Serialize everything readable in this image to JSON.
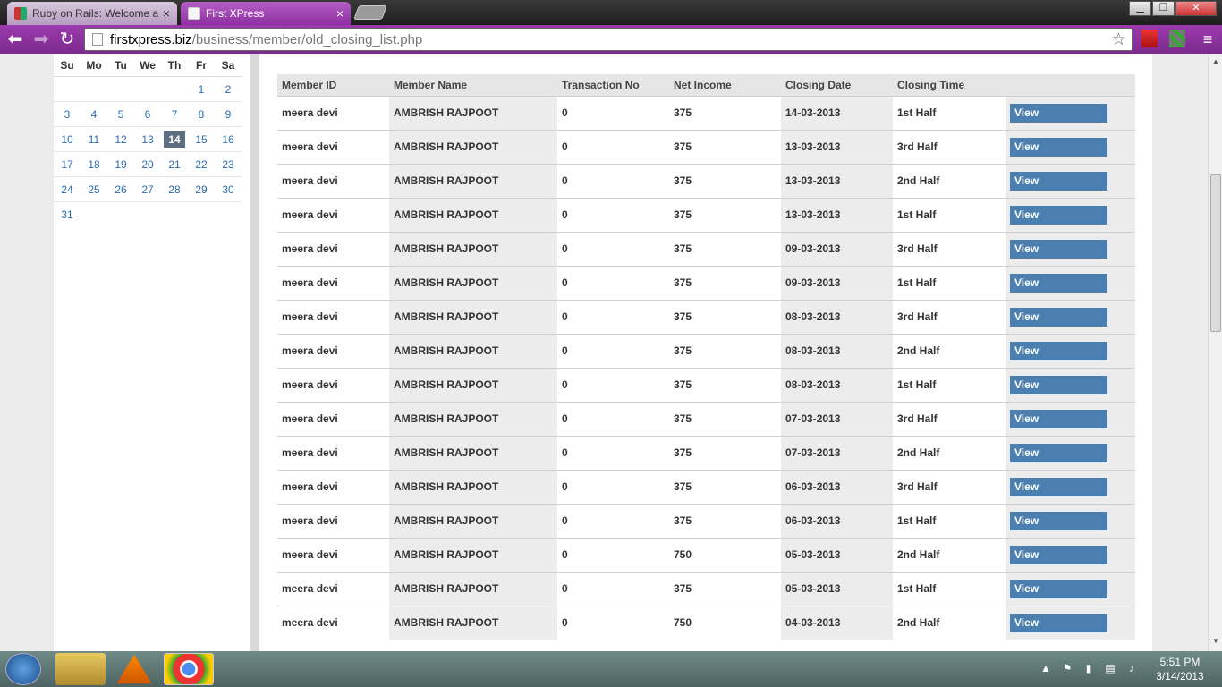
{
  "browser": {
    "tabs": [
      {
        "title": "Ruby on Rails: Welcome a",
        "active": false
      },
      {
        "title": "First XPress",
        "active": true
      }
    ],
    "address": {
      "host": "firstxpress.biz",
      "path": "/business/member/old_closing_list.php"
    }
  },
  "calendar": {
    "weekdays": [
      "Su",
      "Mo",
      "Tu",
      "We",
      "Th",
      "Fr",
      "Sa"
    ],
    "weeks": [
      [
        "",
        "",
        "",
        "",
        "",
        "1",
        "2"
      ],
      [
        "3",
        "4",
        "5",
        "6",
        "7",
        "8",
        "9"
      ],
      [
        "10",
        "11",
        "12",
        "13",
        "14",
        "15",
        "16"
      ],
      [
        "17",
        "18",
        "19",
        "20",
        "21",
        "22",
        "23"
      ],
      [
        "24",
        "25",
        "26",
        "27",
        "28",
        "29",
        "30"
      ],
      [
        "31",
        "",
        "",
        "",
        "",
        "",
        ""
      ]
    ],
    "today": "14"
  },
  "table": {
    "headers": [
      "Member ID",
      "Member Name",
      "Transaction No",
      "Net Income",
      "Closing Date",
      "Closing Time",
      ""
    ],
    "view_label": "View",
    "rows": [
      [
        "meera devi",
        "AMBRISH RAJPOOT",
        "0",
        "375",
        "14-03-2013",
        "1st Half"
      ],
      [
        "meera devi",
        "AMBRISH RAJPOOT",
        "0",
        "375",
        "13-03-2013",
        "3rd Half"
      ],
      [
        "meera devi",
        "AMBRISH RAJPOOT",
        "0",
        "375",
        "13-03-2013",
        "2nd Half"
      ],
      [
        "meera devi",
        "AMBRISH RAJPOOT",
        "0",
        "375",
        "13-03-2013",
        "1st Half"
      ],
      [
        "meera devi",
        "AMBRISH RAJPOOT",
        "0",
        "375",
        "09-03-2013",
        "3rd Half"
      ],
      [
        "meera devi",
        "AMBRISH RAJPOOT",
        "0",
        "375",
        "09-03-2013",
        "1st Half"
      ],
      [
        "meera devi",
        "AMBRISH RAJPOOT",
        "0",
        "375",
        "08-03-2013",
        "3rd Half"
      ],
      [
        "meera devi",
        "AMBRISH RAJPOOT",
        "0",
        "375",
        "08-03-2013",
        "2nd Half"
      ],
      [
        "meera devi",
        "AMBRISH RAJPOOT",
        "0",
        "375",
        "08-03-2013",
        "1st Half"
      ],
      [
        "meera devi",
        "AMBRISH RAJPOOT",
        "0",
        "375",
        "07-03-2013",
        "3rd Half"
      ],
      [
        "meera devi",
        "AMBRISH RAJPOOT",
        "0",
        "375",
        "07-03-2013",
        "2nd Half"
      ],
      [
        "meera devi",
        "AMBRISH RAJPOOT",
        "0",
        "375",
        "06-03-2013",
        "3rd Half"
      ],
      [
        "meera devi",
        "AMBRISH RAJPOOT",
        "0",
        "375",
        "06-03-2013",
        "1st Half"
      ],
      [
        "meera devi",
        "AMBRISH RAJPOOT",
        "0",
        "750",
        "05-03-2013",
        "2nd Half"
      ],
      [
        "meera devi",
        "AMBRISH RAJPOOT",
        "0",
        "375",
        "05-03-2013",
        "1st Half"
      ],
      [
        "meera devi",
        "AMBRISH RAJPOOT",
        "0",
        "750",
        "04-03-2013",
        "2nd Half"
      ]
    ]
  },
  "taskbar": {
    "time": "5:51 PM",
    "date": "3/14/2013"
  },
  "colors": {
    "toolbar": "#8e2fa0",
    "view_button": "#4a7fb0",
    "today_highlight": "#5c6e80"
  }
}
